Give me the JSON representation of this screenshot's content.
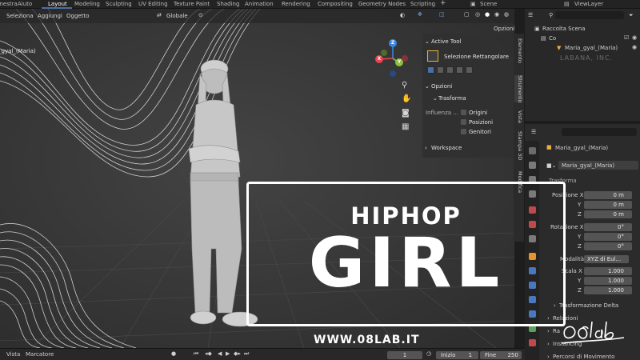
{
  "menu": {
    "items": [
      "Finestra",
      "Aiuto",
      "Layout",
      "Modeling",
      "Sculpting",
      "UV Editing",
      "Texture Paint",
      "Shading",
      "Animation",
      "Rendering",
      "Compositing",
      "Geometry Nodes",
      "Scripting"
    ],
    "active": "Layout",
    "scene_label": "Scene",
    "viewlayer_label": "ViewLayer"
  },
  "viewport_header": {
    "select": "Seleziona",
    "add": "Aggiungi",
    "object": "Oggetto",
    "orientation": "Globale",
    "options": "Opzioni"
  },
  "viewport": {
    "object_label": "_gyal_(Maria)"
  },
  "gizmo": {
    "z": "Z",
    "x": "X",
    "y": "Y"
  },
  "npanel": {
    "active_tool_header": "Active Tool",
    "tool_name": "Selezione Rettangolare",
    "options_header": "Opzioni",
    "transform_header": "Trasforma",
    "affect_label": "Influenza ...",
    "affect_origins": "Origini",
    "affect_positions": "Posizioni",
    "affect_parents": "Genitori",
    "workspace_header": "Workspace"
  },
  "side_tabs": [
    "Elemento",
    "Strumento",
    "Vista",
    "Stampa 3D",
    "Modifica"
  ],
  "outliner": {
    "collection": "Raccolta Scena",
    "child": "Co",
    "object": "Maria_gyal_(Maria)",
    "watermark": "LABANA, INC."
  },
  "properties": {
    "object_name": "Maria_gyal_(Maria)",
    "object_field": "Maria_gyal_(Maria)",
    "section": "Trasforma",
    "location_label": "Posizione X",
    "location": [
      "0 m",
      "0 m",
      "0 m"
    ],
    "rotation_label": "Rotazione X",
    "rotation": [
      "0°",
      "0°",
      "0°"
    ],
    "mode_label": "Modalità",
    "mode_value": "XYZ di Eul...",
    "scale_label": "Scala X",
    "scale": [
      "1.000",
      "1.000",
      "1.000"
    ],
    "axis_y": "Y",
    "axis_z": "Z",
    "delta": "Trasformazione Delta",
    "relations": "Relazioni",
    "collections": "Ra",
    "instancing": "Instancing",
    "motion_paths": "Percorsi di Movimento"
  },
  "timeline": {
    "view": "Vista",
    "marker": "Marcatore",
    "current_frame": "1",
    "start_label": "Inizio",
    "start": "1",
    "end_label": "Fine",
    "end": "250"
  },
  "overlay": {
    "line1": "HIPHOP",
    "line2": "GIRL",
    "website": "WWW.08LAB.IT",
    "signature": "08lab"
  },
  "colors": {
    "accent_blue": "#4a6fa5",
    "axis_x": "#e8434f",
    "axis_y": "#8ac23c",
    "axis_z": "#3d86e0",
    "overlay_white": "#ffffff"
  }
}
